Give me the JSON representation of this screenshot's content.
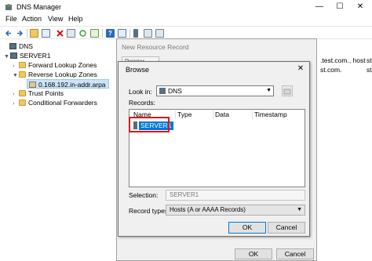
{
  "window": {
    "title": "DNS Manager",
    "minimize": "—",
    "maximize": "☐",
    "close": "✕"
  },
  "menu": [
    "File",
    "Action",
    "View",
    "Help"
  ],
  "tree": {
    "root": "DNS",
    "server": "SERVER1",
    "forward": "Forward Lookup Zones",
    "reverse": "Reverse Lookup Zones",
    "zone": "0.168.192.in-addr.arpa",
    "trust": "Trust Points",
    "conditional": "Conditional Forwarders"
  },
  "right_pane": {
    "text1": ".test.com., host",
    "text2": "st.com.",
    "text3": "st",
    "text4": "st"
  },
  "new_record_dialog": {
    "title": "New Resource Record",
    "tab": "Pointer (PTR)",
    "ok": "OK",
    "cancel": "Cancel"
  },
  "browse": {
    "title": "Browse",
    "close": "✕",
    "look_in_label": "Look in:",
    "look_in_value": "DNS",
    "records_label": "Records:",
    "columns": [
      "Name",
      "Type",
      "Data",
      "Timestamp"
    ],
    "records": [
      {
        "name": "SERVER1"
      }
    ],
    "selection_label": "Selection:",
    "selection_value": "SERVER1",
    "record_types_label": "Record types:",
    "record_types_value": "Hosts (A or AAAA Records)",
    "ok": "OK",
    "cancel": "Cancel"
  }
}
